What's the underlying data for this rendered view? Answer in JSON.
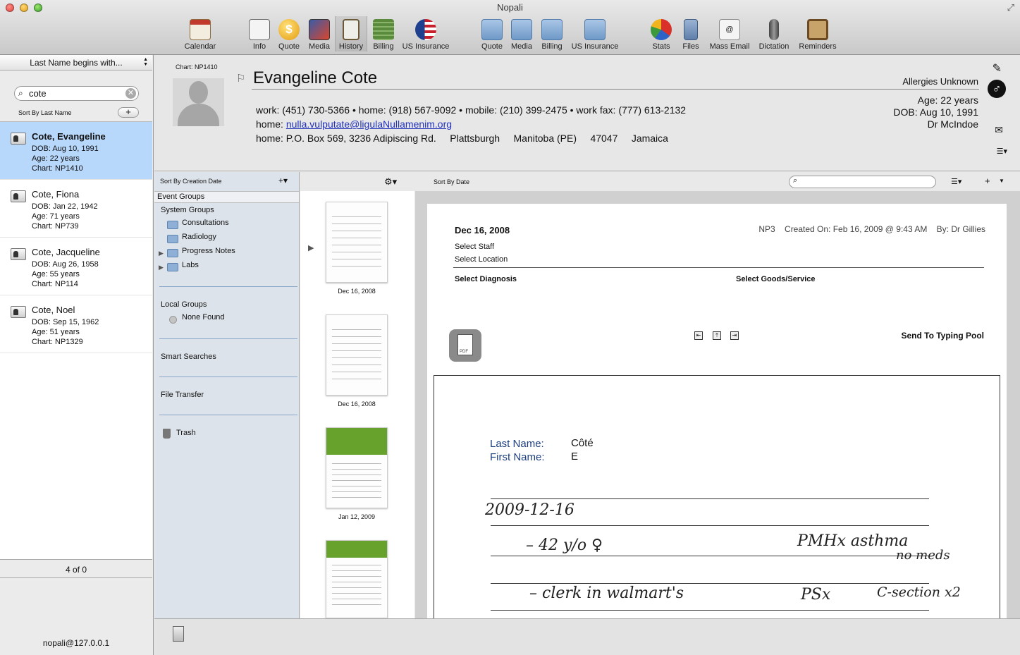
{
  "window": {
    "title": "Nopali"
  },
  "toolbar": {
    "items": [
      {
        "label": "Calendar",
        "icon": "calendar-icon"
      },
      {
        "label": "Info",
        "icon": "info-card-icon"
      },
      {
        "label": "Quote",
        "icon": "dollar-coin-icon"
      },
      {
        "label": "Media",
        "icon": "media-icon"
      },
      {
        "label": "History",
        "icon": "clipboard-icon"
      },
      {
        "label": "Billing",
        "icon": "money-stack-icon"
      },
      {
        "label": "US Insurance",
        "icon": "us-flag-icon"
      },
      {
        "label": "Quote",
        "icon": "folder-quote-icon"
      },
      {
        "label": "Media",
        "icon": "folder-media-icon"
      },
      {
        "label": "Billing",
        "icon": "folder-billing-icon"
      },
      {
        "label": "US Insurance",
        "icon": "folder-insurance-icon"
      },
      {
        "label": "Stats",
        "icon": "pie-chart-icon"
      },
      {
        "label": "Files",
        "icon": "file-cabinet-icon"
      },
      {
        "label": "Mass Email",
        "icon": "mass-email-icon"
      },
      {
        "label": "Dictation",
        "icon": "microphone-icon"
      },
      {
        "label": "Reminders",
        "icon": "corkboard-icon"
      }
    ]
  },
  "sidebar": {
    "filter_label": "Last Name begins with...",
    "search_value": "cote",
    "sort_label": "Sort By Last Name",
    "add_label": "+",
    "patients": [
      {
        "name": "Cote, Evangeline",
        "dob": "DOB: Aug 10, 1991",
        "age": "Age: 22 years",
        "chart": "Chart: NP1410"
      },
      {
        "name": "Cote, Fiona",
        "dob": "DOB: Jan 22, 1942",
        "age": "Age: 71 years",
        "chart": "Chart: NP739"
      },
      {
        "name": "Cote, Jacqueline",
        "dob": "DOB: Aug 26, 1958",
        "age": "Age: 55 years",
        "chart": "Chart: NP114"
      },
      {
        "name": "Cote, Noel",
        "dob": "DOB: Sep 15, 1962",
        "age": "Age: 51 years",
        "chart": "Chart: NP1329"
      }
    ],
    "count": "4 of 0",
    "user": "nopali@127.0.0.1"
  },
  "patient": {
    "chart": "Chart: NP1410",
    "name": "Evangeline Cote",
    "allergies": "Allergies Unknown",
    "age": "Age: 22 years",
    "dob": "DOB: Aug 10, 1991",
    "doctor": "Dr McIndoe",
    "phones": "work: (451) 730-5366  •  home: (918) 567-9092  •  mobile: (210) 399-2475  •  work fax: (777) 613-2132",
    "email_prefix": "home: ",
    "email": "nulla.vulputate@ligulaNullamenim.org",
    "address": "home: P.O. Box 569, 3236 Adipiscing Rd.     Plattsburgh     Manitoba (PE)     47047     Jamaica"
  },
  "groups": {
    "sort_label": "Sort By Creation Date",
    "add_label": "+▾",
    "event_groups": "Event Groups",
    "system_groups": "System Groups",
    "system_items": [
      "Consultations",
      "Radiology",
      "Progress Notes",
      "Labs"
    ],
    "local_groups": "Local Groups",
    "local_none": "None Found",
    "smart_searches": "Smart Searches",
    "file_transfer": "File Transfer",
    "trash": "Trash"
  },
  "thumbnails": {
    "dates": [
      "Dec 16, 2008",
      "Dec 16, 2008",
      "Jan 12, 2009"
    ]
  },
  "document_toolbar": {
    "sort_label": "Sort By Date",
    "search_value": ""
  },
  "document": {
    "date": "Dec 16, 2008",
    "meta": "NP3    Created On: Feb 16, 2009 @ 9:43 AM    By: Dr Gillies",
    "select_staff": "Select Staff",
    "select_location": "Select Location",
    "select_diagnosis": "Select Diagnosis",
    "select_goods": "Select Goods/Service",
    "send_typing_pool": "Send To Typing Pool",
    "scan": {
      "last_name_label": "Last Name:",
      "last_name_value": "Côté",
      "first_name_label": "First Name:",
      "first_name_value": "E",
      "handwriting": [
        "2009-12-16",
        "– 42 y/o ♀",
        "PMHx  asthma",
        "no meds",
        "– clerk in walmart's",
        "PSx",
        "C-section x2"
      ]
    }
  },
  "colors": {
    "selection": "#b7d7fb",
    "link": "#2233bb",
    "scan_label": "#1d3f7f",
    "thumb_green": "#66a22c"
  }
}
